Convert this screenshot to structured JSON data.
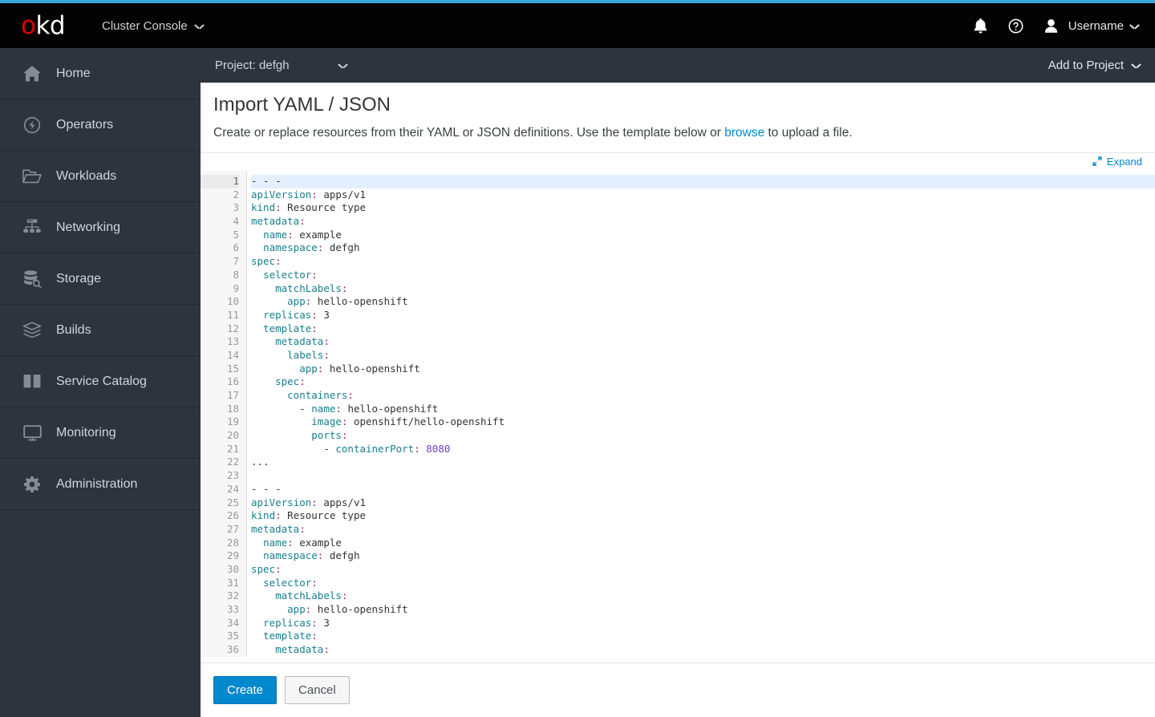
{
  "masthead": {
    "logo_o": "o",
    "logo_kd": "kd",
    "console_switcher_label": "Cluster Console",
    "notifications_icon": "bell-icon",
    "help_icon": "help-circle-icon",
    "user_icon": "user-avatar-icon",
    "username": "Username",
    "accent_color": "#39a5dc",
    "background_color": "#030303"
  },
  "sidebar": {
    "background_color": "#2e343e",
    "items": [
      {
        "label": "Home",
        "icon": "home-icon"
      },
      {
        "label": "Operators",
        "icon": "operators-icon"
      },
      {
        "label": "Workloads",
        "icon": "folder-icon"
      },
      {
        "label": "Networking",
        "icon": "network-icon"
      },
      {
        "label": "Storage",
        "icon": "database-search-icon"
      },
      {
        "label": "Builds",
        "icon": "layers-icon"
      },
      {
        "label": "Service Catalog",
        "icon": "book-icon"
      },
      {
        "label": "Monitoring",
        "icon": "monitor-icon"
      },
      {
        "label": "Administration",
        "icon": "gear-icon"
      }
    ]
  },
  "project_bar": {
    "project_label": "Project: defgh",
    "add_to_project_label": "Add to Project"
  },
  "panel": {
    "title": "Import YAML / JSON",
    "description_before": "Create or replace resources from their YAML or JSON definitions. Use the template below or ",
    "description_link": "browse",
    "description_after": " to upload a file.",
    "expand_label": "Expand",
    "expand_icon": "expand-arrows-icon",
    "link_color": "#0088ce"
  },
  "editor": {
    "active_line": 1,
    "first_line_number": 1,
    "last_line_number": 36,
    "active_line_bg": "#e3effd",
    "key_color": "#17808f",
    "colon_color": "#a0264e",
    "number_color": "#6c3ebd",
    "lines": [
      {
        "n": 1,
        "indent": 0,
        "type": "doc",
        "text": "- - -"
      },
      {
        "n": 2,
        "indent": 0,
        "type": "kv",
        "key": "apiVersion",
        "value": "apps/v1"
      },
      {
        "n": 3,
        "indent": 0,
        "type": "kv",
        "key": "kind",
        "value": "Resource type"
      },
      {
        "n": 4,
        "indent": 0,
        "type": "k",
        "key": "metadata"
      },
      {
        "n": 5,
        "indent": 1,
        "type": "kv",
        "key": "name",
        "value": "example"
      },
      {
        "n": 6,
        "indent": 1,
        "type": "kv",
        "key": "namespace",
        "value": "defgh"
      },
      {
        "n": 7,
        "indent": 0,
        "type": "k",
        "key": "spec"
      },
      {
        "n": 8,
        "indent": 1,
        "type": "k",
        "key": "selector"
      },
      {
        "n": 9,
        "indent": 2,
        "type": "k",
        "key": "matchLabels"
      },
      {
        "n": 10,
        "indent": 3,
        "type": "kv",
        "key": "app",
        "value": "hello-openshift"
      },
      {
        "n": 11,
        "indent": 1,
        "type": "kv",
        "key": "replicas",
        "value": "3"
      },
      {
        "n": 12,
        "indent": 1,
        "type": "k",
        "key": "template"
      },
      {
        "n": 13,
        "indent": 2,
        "type": "k",
        "key": "metadata"
      },
      {
        "n": 14,
        "indent": 3,
        "type": "k",
        "key": "labels"
      },
      {
        "n": 15,
        "indent": 4,
        "type": "kv",
        "key": "app",
        "value": "hello-openshift"
      },
      {
        "n": 16,
        "indent": 2,
        "type": "k",
        "key": "spec"
      },
      {
        "n": 17,
        "indent": 3,
        "type": "k",
        "key": "containers"
      },
      {
        "n": 18,
        "indent": 4,
        "type": "lkv",
        "key": "name",
        "value": "hello-openshift"
      },
      {
        "n": 19,
        "indent": 5,
        "type": "kv",
        "key": "image",
        "value": "openshift/hello-openshift"
      },
      {
        "n": 20,
        "indent": 5,
        "type": "k",
        "key": "ports"
      },
      {
        "n": 21,
        "indent": 6,
        "type": "lknum",
        "key": "containerPort",
        "value": "8080"
      },
      {
        "n": 22,
        "indent": 0,
        "type": "raw",
        "text": "..."
      },
      {
        "n": 23,
        "indent": 0,
        "type": "raw",
        "text": ""
      },
      {
        "n": 24,
        "indent": 0,
        "type": "doc",
        "text": "- - -"
      },
      {
        "n": 25,
        "indent": 0,
        "type": "kv",
        "key": "apiVersion",
        "value": "apps/v1"
      },
      {
        "n": 26,
        "indent": 0,
        "type": "kv",
        "key": "kind",
        "value": "Resource type"
      },
      {
        "n": 27,
        "indent": 0,
        "type": "k",
        "key": "metadata"
      },
      {
        "n": 28,
        "indent": 1,
        "type": "kv",
        "key": "name",
        "value": "example"
      },
      {
        "n": 29,
        "indent": 1,
        "type": "kv",
        "key": "namespace",
        "value": "defgh"
      },
      {
        "n": 30,
        "indent": 0,
        "type": "k",
        "key": "spec"
      },
      {
        "n": 31,
        "indent": 1,
        "type": "k",
        "key": "selector"
      },
      {
        "n": 32,
        "indent": 2,
        "type": "k",
        "key": "matchLabels"
      },
      {
        "n": 33,
        "indent": 3,
        "type": "kv",
        "key": "app",
        "value": "hello-openshift"
      },
      {
        "n": 34,
        "indent": 1,
        "type": "kv",
        "key": "replicas",
        "value": "3"
      },
      {
        "n": 35,
        "indent": 1,
        "type": "k",
        "key": "template"
      },
      {
        "n": 36,
        "indent": 2,
        "type": "k",
        "key": "metadata"
      }
    ]
  },
  "footer": {
    "create_label": "Create",
    "cancel_label": "Cancel",
    "primary_color": "#0088ce"
  }
}
